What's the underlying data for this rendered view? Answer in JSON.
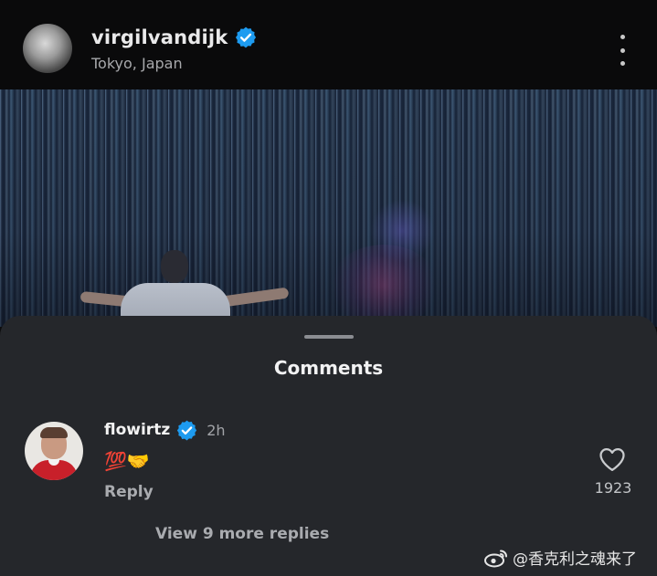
{
  "post": {
    "username": "virgilvandijk",
    "location": "Tokyo, Japan"
  },
  "comments_sheet": {
    "title": "Comments",
    "comment": {
      "username": "flowirtz",
      "time": "2h",
      "text": "💯🤝",
      "reply_label": "Reply",
      "like_count": "1923"
    },
    "view_more_label": "View 9 more replies"
  },
  "watermark": {
    "text": "@香克利之魂来了"
  },
  "colors": {
    "verified_blue": "#1d9bf0",
    "sheet_bg": "#25272b",
    "header_bg": "#0a0a0b"
  },
  "icons": [
    "verified-badge-icon",
    "more-options-icon",
    "heart-icon",
    "weibo-logo-icon"
  ]
}
